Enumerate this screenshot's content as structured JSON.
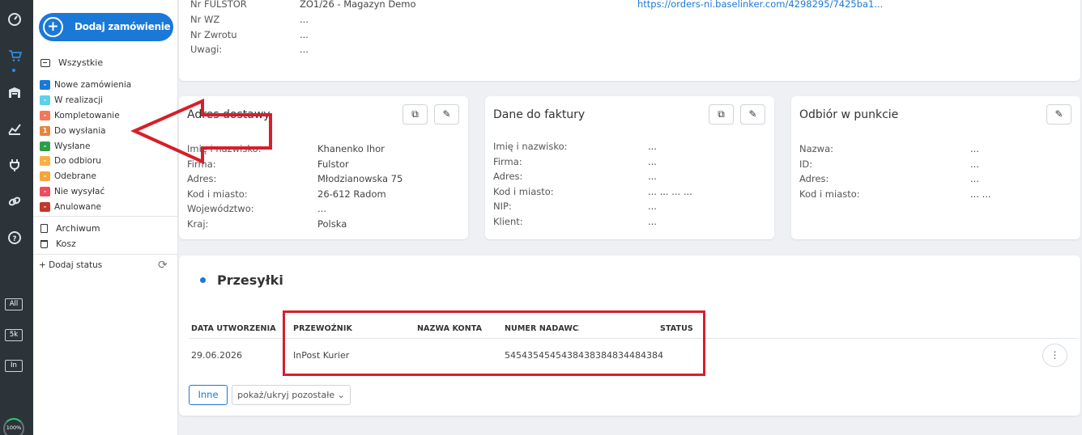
{
  "rail": {
    "icons": [
      "dashboard-icon",
      "cart-icon",
      "warehouse-icon",
      "chart-icon",
      "plug-icon",
      "link-icon",
      "help-icon"
    ],
    "chips": [
      "All",
      "5k",
      "In"
    ],
    "progress": "100%"
  },
  "sidebar": {
    "add_order_label": "Dodaj zamówienie",
    "all_label": "Wszystkie",
    "statuses": [
      {
        "label": "Nowe zamówienia",
        "badge": "-",
        "color": "#1a78d7"
      },
      {
        "label": "W realizacji",
        "badge": "-",
        "color": "#5bd0ef"
      },
      {
        "label": "Kompletowanie",
        "badge": "-",
        "color": "#f0785a"
      },
      {
        "label": "Do wysłania",
        "badge": "1",
        "color": "#e8843a"
      },
      {
        "label": "Wysłane",
        "badge": "-",
        "color": "#2e9e4b"
      },
      {
        "label": "Do odbioru",
        "badge": "-",
        "color": "#f5b041"
      },
      {
        "label": "Odebrane",
        "badge": "-",
        "color": "#f3a53d"
      },
      {
        "label": "Nie wysyłać",
        "badge": "-",
        "color": "#ee4d5f"
      },
      {
        "label": "Anulowane",
        "badge": "-",
        "color": "#c0392b"
      }
    ],
    "archive_label": "Archiwum",
    "trash_label": "Kosz",
    "add_status_label": "+ Dodaj status"
  },
  "top_card": {
    "rows": [
      {
        "label": "Nr FULSTOR",
        "value": "ZO1/26 - Magazyn Demo"
      },
      {
        "label": "Nr WZ",
        "value": "..."
      },
      {
        "label": "Nr Zwrotu",
        "value": "..."
      },
      {
        "label": "Uwagi:",
        "value": "..."
      }
    ],
    "link": "https://orders-ni.baselinker.com/4298295/7425ba1..."
  },
  "delivery": {
    "title": "Adres dostawy",
    "rows": [
      {
        "label": "Imię i nazwisko:",
        "value": "Khanenko Ihor"
      },
      {
        "label": "Firma:",
        "value": "Fulstor"
      },
      {
        "label": "Adres:",
        "value": "Młodzianowska 75"
      },
      {
        "label": "Kod i miasto:",
        "value": "26-612   Radom"
      },
      {
        "label": "Województwo:",
        "value": "..."
      },
      {
        "label": "Kraj:",
        "value": "Polska"
      }
    ]
  },
  "invoice": {
    "title": "Dane do faktury",
    "rows": [
      {
        "label": "Imię i nazwisko:",
        "value": "..."
      },
      {
        "label": "Firma:",
        "value": "..."
      },
      {
        "label": "Adres:",
        "value": "..."
      },
      {
        "label": "Kod i miasto:",
        "value": "...   ...   ...   ..."
      },
      {
        "label": "NIP:",
        "value": "..."
      },
      {
        "label": "Klient:",
        "value": "..."
      }
    ]
  },
  "pickup": {
    "title": "Odbiór w punkcie",
    "rows": [
      {
        "label": "Nazwa:",
        "value": "..."
      },
      {
        "label": "ID:",
        "value": "..."
      },
      {
        "label": "Adres:",
        "value": "..."
      },
      {
        "label": "Kod i miasto:",
        "value": "...     ..."
      }
    ]
  },
  "shipments": {
    "title": "Przesyłki",
    "columns": [
      "DATA UTWORZENIA",
      "PRZEWOŹNIK",
      "NAZWA KONTA",
      "NUMER NADAWCZY",
      "STATUS"
    ],
    "row": {
      "date": "29.06.2026",
      "carrier": "InPost Kurier",
      "account": "",
      "tracking": "5454354545438438384834484384",
      "status": ""
    },
    "btn_other": "Inne",
    "btn_toggle": "pokaż/ukryj pozostałe"
  },
  "colors": {
    "accent": "#1a78d7",
    "annotation": "#d81e2b",
    "rail": "#2c3439"
  }
}
